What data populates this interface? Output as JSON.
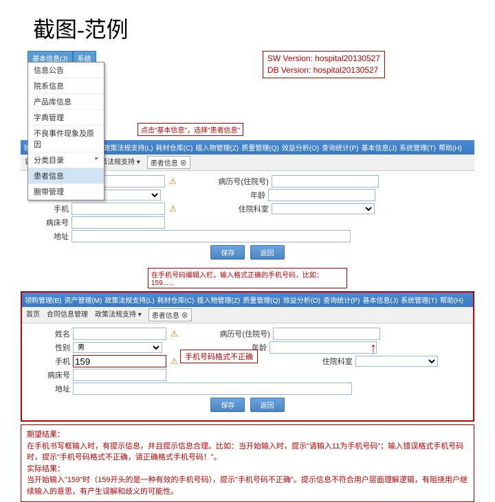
{
  "slide_title": "截图-范例",
  "top_menu": {
    "tab1": "基本信息(J)",
    "tab2": "系统"
  },
  "dropdown_items": [
    "信息公告",
    "院系信息",
    "产品库信息",
    "字典管理",
    "不良事件现象及原因",
    "分类目录",
    "患者信息",
    "腕带管理"
  ],
  "version": {
    "sw": "SW Version: hospital20130527",
    "db": "DB Version: hospital20130527"
  },
  "callout1": "点击\"基本信息\"，选择\"患者信息\"",
  "nav": [
    "首页",
    "领购管理(B)",
    "资产管理(M)",
    "政策法规支持(L)",
    "耗材仓库(C)",
    "植入物管理(Z)",
    "质量管理(Q)",
    "效益分析(O)",
    "查询统计(P)",
    "基本信息(J)",
    "系统管理(T)",
    "帮助(H)"
  ],
  "sub_tabs": {
    "t1": "首页",
    "t2": "合同信息管理",
    "t3": "政策法规支持",
    "t4": "患者信息"
  },
  "form": {
    "name_label": "姓名",
    "sex_label": "性别",
    "sex_value": "男",
    "phone_label": "手机",
    "bed_label": "病床号",
    "addr_label": "地址",
    "record_label": "病历号(住院号)",
    "age_label": "年龄",
    "dept_label": "住院科室",
    "phone_value2": "159"
  },
  "buttons": {
    "save": "保存",
    "back": "返回"
  },
  "callout2": "在手机号码编辑入栏，输入格式正确的手机号码，比如：159......",
  "error_tip": "手机号码格式不正确",
  "result": {
    "h1": "期望结果：",
    "p1": "在手机书写框输入时，有提示信息，并且提示信息合理。比如：当开始输入时，提示\"请输入11为手机号码\"；输入错误格式手机号码时，提示\"手机号码格式不正确，请正确格式手机号码！\"。",
    "h2": "实际结果：",
    "p2": "当开始输入\"159\"时（159开头的是一种有效的手机号码），提示\"手机号码不正确\"。提示信息不符合用户层面理解逻辑，有阻挠用户继续输入的意思，有产生误解和歧义的可能性。"
  }
}
